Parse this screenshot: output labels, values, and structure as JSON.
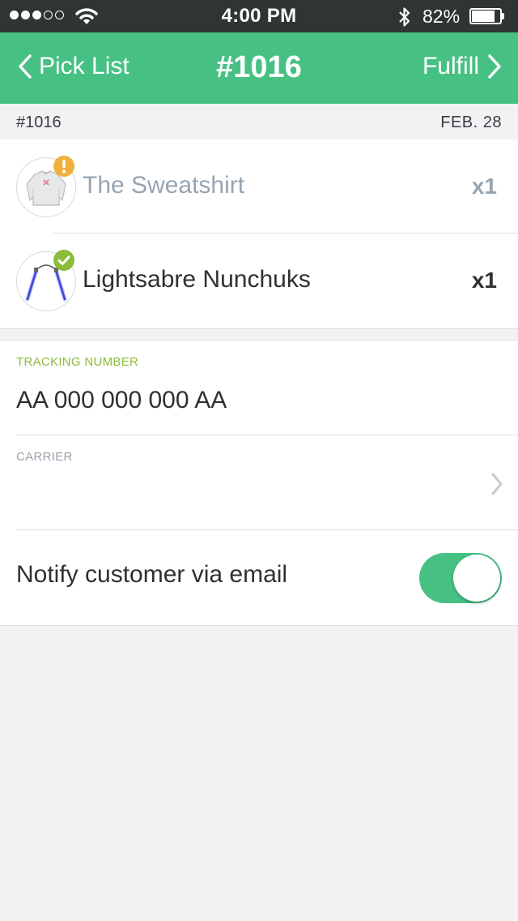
{
  "status_bar": {
    "signal_bars": [
      true,
      true,
      true,
      false,
      false
    ],
    "time": "4:00 PM",
    "battery_percent": "82%",
    "battery_level": 0.82
  },
  "nav": {
    "back_label": "Pick List",
    "title": "#1016",
    "action_label": "Fulfill"
  },
  "order_meta": {
    "order_number": "#1016",
    "date": "FEB. 28"
  },
  "items": [
    {
      "name": "The Sweatshirt",
      "quantity": "x1",
      "status": "warning",
      "status_icon": "exclamation-icon",
      "thumbnail": "sweatshirt-thumbnail"
    },
    {
      "name": "Lightsabre Nunchuks",
      "quantity": "x1",
      "status": "done",
      "status_icon": "checkmark-icon",
      "thumbnail": "nunchuks-thumbnail"
    }
  ],
  "form": {
    "tracking_label": "TRACKING NUMBER",
    "tracking_value": "AA 000 000 000 AA",
    "carrier_label": "CARRIER",
    "carrier_value": "",
    "notify_label": "Notify customer via email",
    "notify_enabled": true
  },
  "colors": {
    "accent": "#47c183",
    "warning": "#f0b03c",
    "success": "#8dbb3a",
    "status_bar_bg": "#2f3532",
    "background": "#f1f2f4"
  }
}
